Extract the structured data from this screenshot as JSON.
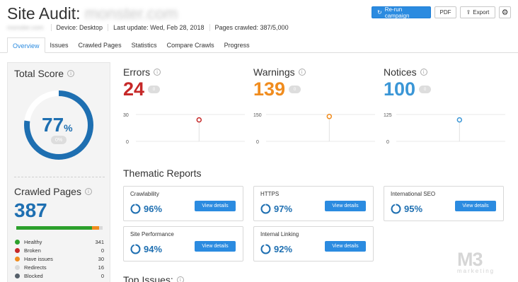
{
  "header": {
    "title": "Site Audit:",
    "domain": "monster.com",
    "domain_small": "monster.com",
    "device": "Device: Desktop",
    "last_update": "Last update: Wed, Feb 28, 2018",
    "pages_crawled": "Pages crawled: 387/5,000"
  },
  "actions": {
    "rerun": "Re-run campaign",
    "pdf": "PDF",
    "export": "Export",
    "settings_icon": "gear-icon"
  },
  "tabs": [
    "Overview",
    "Issues",
    "Crawled Pages",
    "Statistics",
    "Compare Crawls",
    "Progress"
  ],
  "total_score": {
    "title": "Total Score",
    "value": "77",
    "unit": "%",
    "value_fraction": 0.77,
    "delta": "0%"
  },
  "crawled_pages": {
    "title": "Crawled Pages",
    "value": "387",
    "legend": [
      {
        "label": "Healthy",
        "count": "341",
        "color": "#2ca02c"
      },
      {
        "label": "Broken",
        "count": "0",
        "color": "#c62828"
      },
      {
        "label": "Have issues",
        "count": "30",
        "color": "#f08c1e"
      },
      {
        "label": "Redirects",
        "count": "16",
        "color": "#d9d9d9"
      },
      {
        "label": "Blocked",
        "count": "0",
        "color": "#56606a"
      }
    ]
  },
  "metrics": [
    {
      "title": "Errors",
      "value": "24",
      "delta": "0",
      "color": "#c62828",
      "y_max": "30",
      "y_min": "0",
      "point_value": 24,
      "y_limit": 30
    },
    {
      "title": "Warnings",
      "value": "139",
      "delta": "0",
      "color": "#f08c1e",
      "y_max": "150",
      "y_min": "0",
      "point_value": 139,
      "y_limit": 150
    },
    {
      "title": "Notices",
      "value": "100",
      "delta": "0",
      "color": "#3a96d6",
      "y_max": "125",
      "y_min": "0",
      "point_value": 100,
      "y_limit": 125
    }
  ],
  "thematic": {
    "title": "Thematic Reports",
    "view_label": "View details",
    "cards": [
      {
        "title": "Crawlability",
        "pct": "96%",
        "value": 0.96
      },
      {
        "title": "HTTPS",
        "pct": "97%",
        "value": 0.97
      },
      {
        "title": "International SEO",
        "pct": "95%",
        "value": 0.95
      },
      {
        "title": "Site Performance",
        "pct": "94%",
        "value": 0.94
      },
      {
        "title": "Internal Linking",
        "pct": "92%",
        "value": 0.92
      }
    ]
  },
  "top_issues": {
    "title": "Top Issues:"
  },
  "watermark": {
    "main": "M3",
    "sub": "marketing"
  },
  "colors": {
    "accent": "#2b8be0",
    "score": "#1e6fb1"
  }
}
